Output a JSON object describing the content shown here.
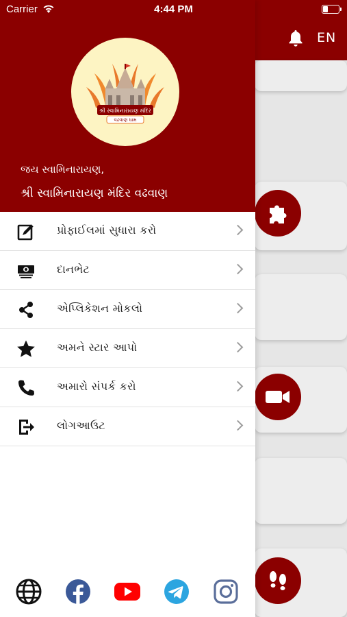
{
  "status_bar": {
    "carrier": "Carrier",
    "time": "4:44 PM"
  },
  "background_app": {
    "lang_toggle": "EN"
  },
  "drawer": {
    "greeting": "જય સ્વામિનારાયણ,",
    "mandir_name": "શ્રી સ્વામિનારાયણ મંદિર વઢવાણ",
    "logo": {
      "banner_text": "શ્રી સ્વામિનારાયણ મંદિર",
      "place_text": "વઢવાણ ધામ"
    },
    "menu": [
      {
        "label": "પ્રોફાઈલમાં સુધારા કરો",
        "icon": "edit-profile-icon"
      },
      {
        "label": "દાનભેટ",
        "icon": "donation-money-icon"
      },
      {
        "label": "એપ્લિકેશન મોકલો",
        "icon": "share-icon"
      },
      {
        "label": "અમને સ્ટાર આપો",
        "icon": "star-icon"
      },
      {
        "label": "અમારો સંપર્ક કરો",
        "icon": "phone-icon"
      },
      {
        "label": "લોગઆઉટ",
        "icon": "logout-icon"
      }
    ],
    "socials": [
      "website-globe-icon",
      "facebook-icon",
      "youtube-icon",
      "telegram-icon",
      "instagram-icon"
    ]
  },
  "colors": {
    "primary": "#8b0000",
    "logo_bg": "#fdf4c3",
    "facebook": "#3b5998",
    "youtube": "#ff0000",
    "telegram": "#2ca5e0",
    "instagram": "#5a6e9a"
  }
}
